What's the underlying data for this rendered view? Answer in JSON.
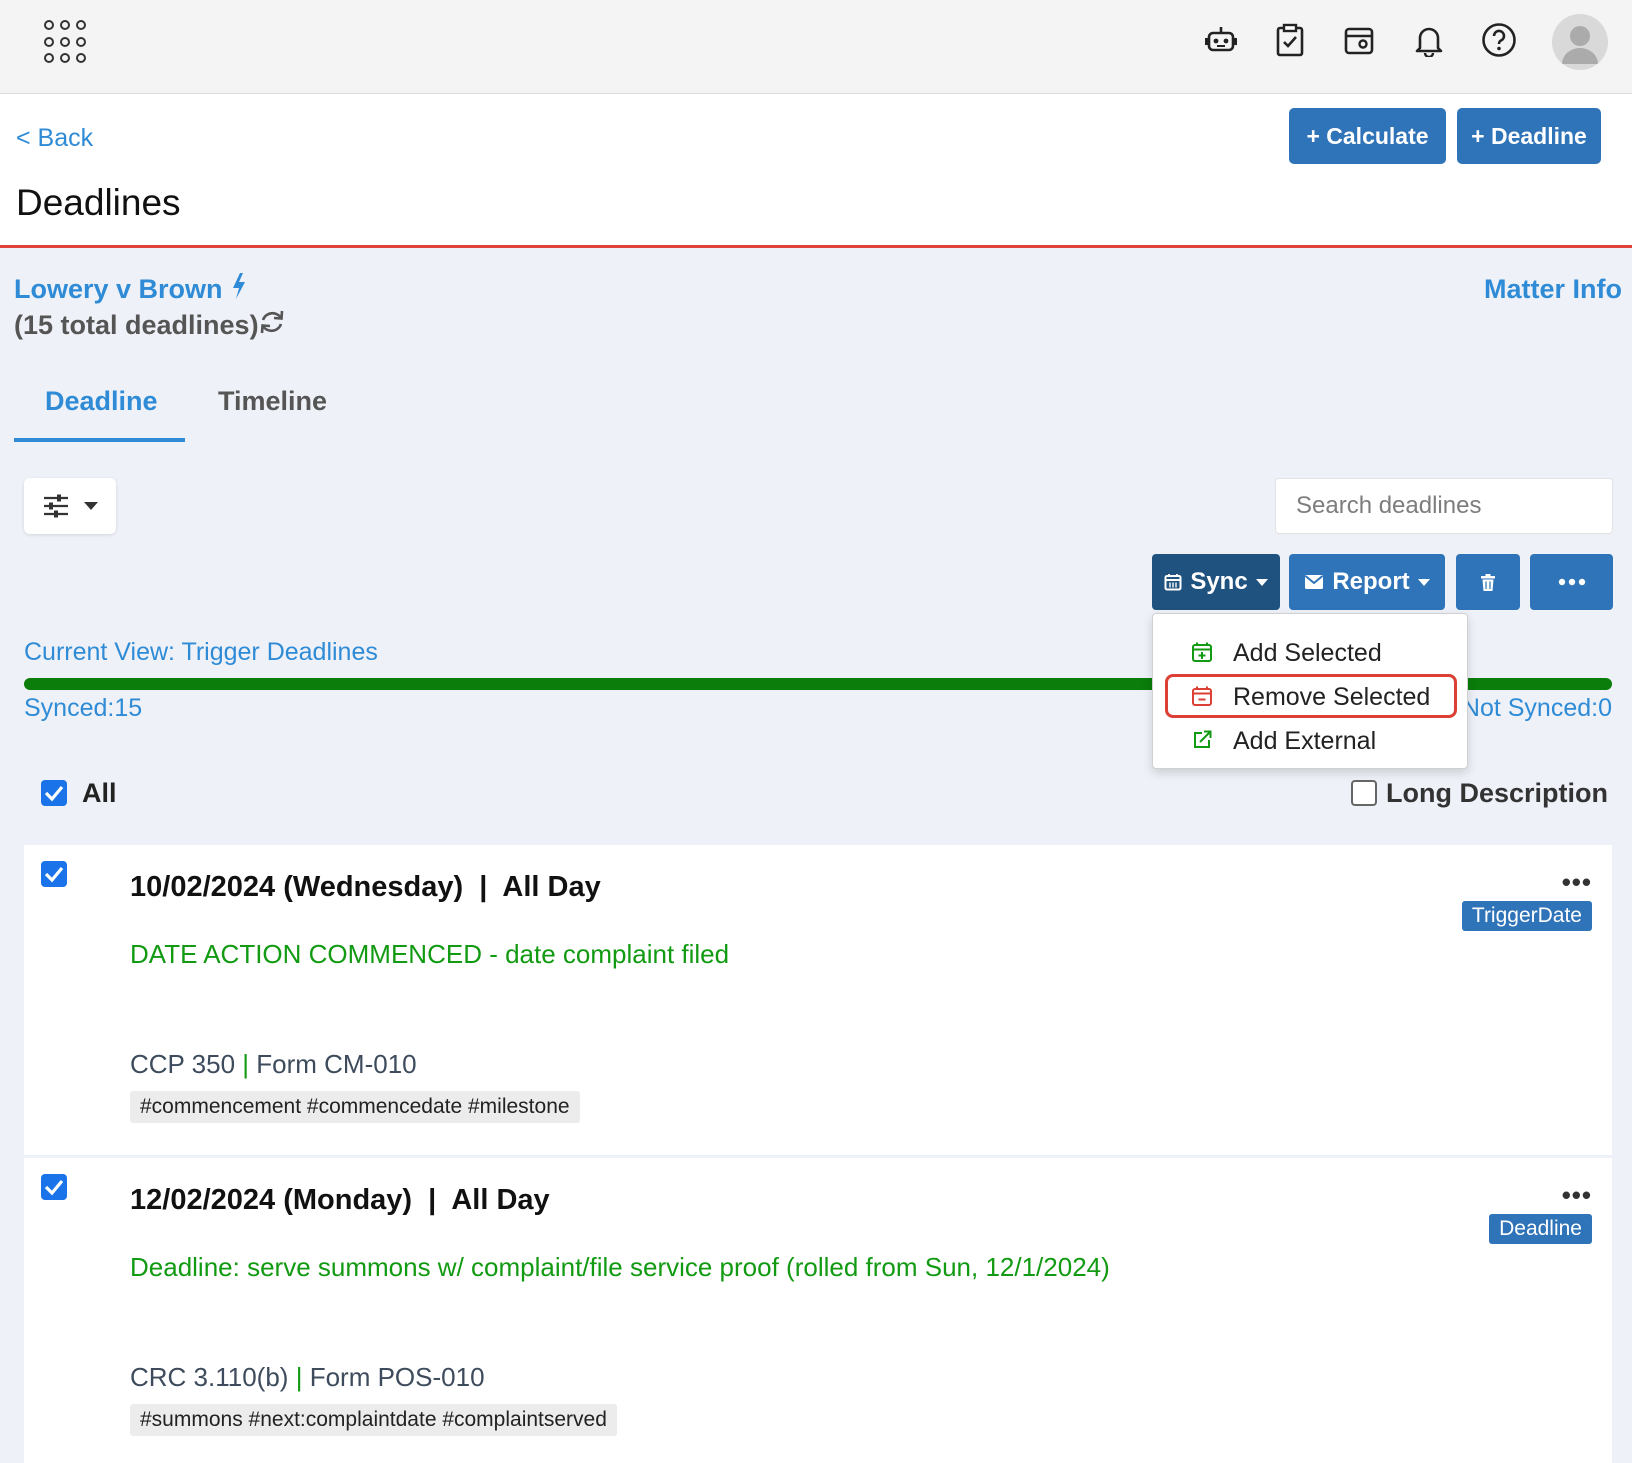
{
  "topbar": {
    "icons": [
      "apps-grid-icon",
      "robot-icon",
      "clipboard-check-icon",
      "calendar-view-icon",
      "bell-icon",
      "help-icon",
      "user-avatar-icon"
    ]
  },
  "header": {
    "back_label": "< Back",
    "title": "Deadlines",
    "calculate_label": "+ Calculate",
    "deadline_label": "+ Deadline"
  },
  "matter": {
    "name": "Lowery v Brown",
    "total": "(15 total deadlines)",
    "info_link": "Matter Info"
  },
  "tabs": [
    {
      "label": "Deadline",
      "active": true
    },
    {
      "label": "Timeline",
      "active": false
    }
  ],
  "search": {
    "placeholder": "Search deadlines"
  },
  "actions": {
    "sync_label": "Sync",
    "report_label": "Report"
  },
  "sync_menu": {
    "items": [
      {
        "label": "Add Selected",
        "icon": "calendar-plus-icon",
        "color": "#129a12"
      },
      {
        "label": "Remove Selected",
        "icon": "calendar-minus-icon",
        "color": "#dc3f33"
      },
      {
        "label": "Add External",
        "icon": "external-link-icon",
        "color": "#129a12"
      }
    ]
  },
  "view": {
    "current": "Current View: Trigger Deadlines",
    "synced": "Synced:15",
    "not_synced": "Not Synced:0",
    "synced_fraction": 1.0
  },
  "list": {
    "all_label": "All",
    "all_checked": true,
    "long_desc_label": "Long Description",
    "long_desc_checked": false
  },
  "deadlines": [
    {
      "date": "10/02/2024 (Wednesday)  |  All Day",
      "badge": "TriggerDate",
      "description": "DATE ACTION COMMENCED - date complaint filed",
      "rule": "CCP 350",
      "separator": "|",
      "form": "Form CM-010",
      "tags": "#commencement #commencedate #milestone",
      "checked": true
    },
    {
      "date": "12/02/2024 (Monday)  |  All Day",
      "badge": "Deadline",
      "description": "Deadline: serve summons w/ complaint/file service proof (rolled from Sun, 12/1/2024)",
      "rule": "CRC 3.110(b)",
      "separator": "|",
      "form": "Form POS-010",
      "tags": "#summons #next:complaintdate #complaintserved",
      "checked": true
    }
  ],
  "colors": {
    "primary": "#2f73b8",
    "link": "#2f8bd6",
    "accent_red": "#e0413a",
    "success_green": "#0a7d0a"
  }
}
